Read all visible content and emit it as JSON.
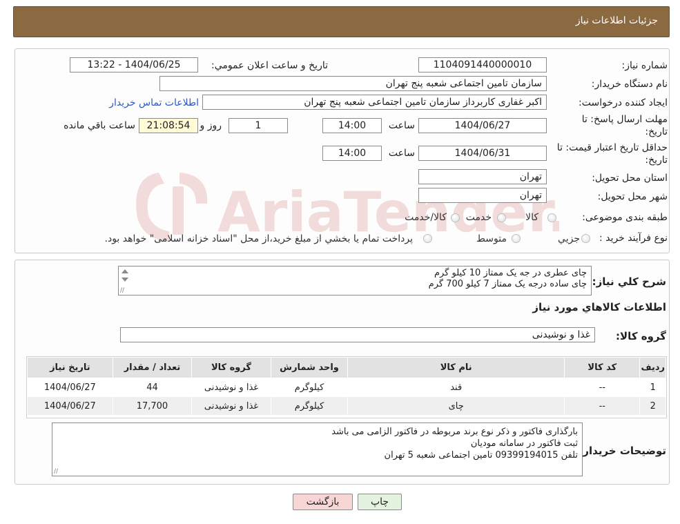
{
  "header": {
    "title": "جزئیات اطلاعات نیاز"
  },
  "form": {
    "need_number_label": "شماره نیاز:",
    "need_number": "1104091440000010",
    "announce_label": "تاریخ و ساعت اعلان عمومي:",
    "announce_value": "1404/06/25 - 13:22",
    "buyer_org_label": "نام دستگاه خريدار:",
    "buyer_org": "سازمان تامین اجتماعی شعبه پنج تهران",
    "creator_label": "ايجاد کننده درخواست:",
    "creator": "اکبر غفاری کاربرداز  سازمان تامین اجتماعی شعبه پنج تهران",
    "contact_link": "اطلاعات تماس خريدار",
    "deadline_label_1": "مهلت ارسال پاسخ: تا",
    "deadline_label_2": "تاريخ:",
    "deadline_date": "1404/06/27",
    "time_label": "ساعت",
    "deadline_time": "14:00",
    "days_value": "1",
    "days_label": "روز و",
    "remaining_time": "21:08:54",
    "remaining_label": "ساعت باقي مانده",
    "validity_label_1": "حداقل تاريخ اعتبار قيمت: تا",
    "validity_label_2": "تاريخ:",
    "validity_date": "1404/06/31",
    "validity_time_label": "ساعت",
    "validity_time": "14:00",
    "province_label": "استان محل تحويل:",
    "province": "تهران",
    "city_label": "شهر محل تحويل:",
    "city": "تهران",
    "category_label": "طبقه بندی موضوعی:",
    "category_options": [
      "کالا",
      "خدمت",
      "کالا/خدمت"
    ],
    "process_label": "نوع فرآيند خريد :",
    "process_options": [
      "جزيي",
      "متوسط"
    ],
    "process_note": "پرداخت تمام يا بخشي از مبلغ خريد،از محل \"اسناد خزانه اسلامی\" خواهد بود."
  },
  "description": {
    "label": "شرح کلي نياز:",
    "lines": [
      "چای   عطری در جه یک ممتاز   10 کیلو گرم",
      "چای   ساده درجه یک ممتاز 7 کیلو 700 گرم"
    ]
  },
  "goods": {
    "section_title": "اطلاعات کالاهاي مورد نياز",
    "group_label": "گروه کالا:",
    "group_value": "غذا و نوشیدنی",
    "table": {
      "headers": [
        "رديف",
        "کد کالا",
        "نام کالا",
        "واحد شمارش",
        "گروه کالا",
        "تعداد / مقدار",
        "تاريخ نياز"
      ],
      "rows": [
        [
          "1",
          "--",
          "قند",
          "کیلوگرم",
          "غذا و نوشیدنی",
          "44",
          "1404/06/27"
        ],
        [
          "2",
          "--",
          "چای",
          "کیلوگرم",
          "غذا و نوشیدنی",
          "17,700",
          "1404/06/27"
        ]
      ]
    }
  },
  "buyer_notes": {
    "label": "توضيحات خريدار:",
    "lines": [
      "بارگذاری فاکتور و ذکر نوع برند مربوطه در فاکتور الزامی می باشد",
      "ثبت فاکتور در سامانه مودیان",
      "تلفن 09399194015   تامین اجتماعی شعبه 5 تهران"
    ]
  },
  "buttons": {
    "print": "چاپ",
    "back": "بازگشت"
  },
  "colors": {
    "header": "#8b6a41",
    "back_button": "#f8d6d6",
    "print_button": "#e3f3df",
    "link": "#2d56c8"
  }
}
